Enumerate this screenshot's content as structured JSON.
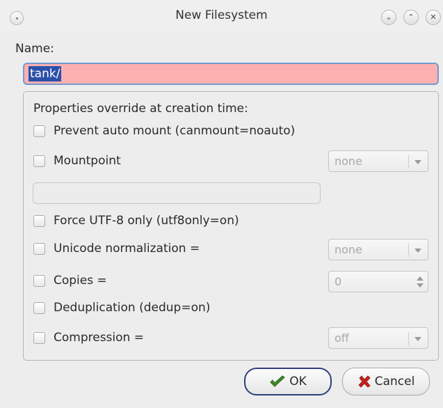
{
  "window": {
    "title": "New Filesystem",
    "controls": {
      "minimize": "⌄",
      "maximize": "⌃",
      "close": "✕"
    }
  },
  "name_field": {
    "label": "Name:",
    "value": "tank/"
  },
  "properties": {
    "group_title": "Properties override at creation time:",
    "prevent_auto_mount": "Prevent auto mount (canmount=noauto)",
    "mountpoint": {
      "label": "Mountpoint",
      "combo_value": "none",
      "path_value": ""
    },
    "force_utf8": "Force UTF-8 only (utf8only=on)",
    "unicode_normalization": {
      "label": "Unicode normalization =",
      "combo_value": "none"
    },
    "copies": {
      "label": "Copies =",
      "spin_value": "0"
    },
    "deduplication": "Deduplication (dedup=on)",
    "compression": {
      "label": "Compression =",
      "combo_value": "off"
    }
  },
  "buttons": {
    "ok": "OK",
    "cancel": "Cancel"
  },
  "colors": {
    "name_invalid_bg": "#fdb0b0",
    "focus_border": "#6f9bd1",
    "selection": "#2b50a8",
    "ok_icon": "#3f8a2b",
    "cancel_icon": "#c62020"
  },
  "icons": {
    "ok": "green-checkmark-icon",
    "cancel": "red-x-icon"
  }
}
